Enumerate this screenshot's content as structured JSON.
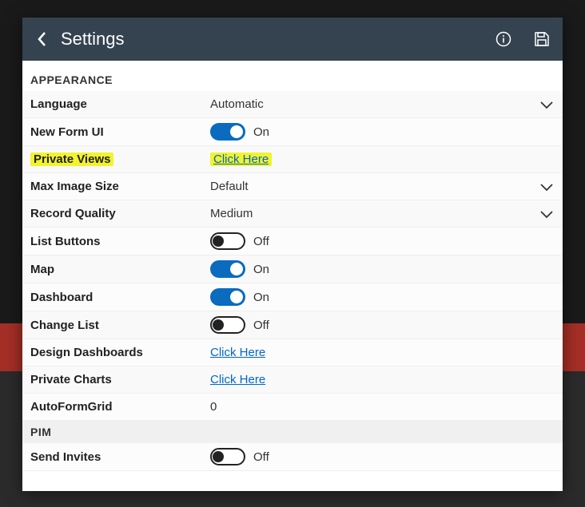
{
  "header": {
    "title": "Settings"
  },
  "sections": {
    "appearance": {
      "title": "APPEARANCE",
      "language": {
        "label": "Language",
        "value": "Automatic"
      },
      "newFormUI": {
        "label": "New Form UI",
        "value": "On",
        "on": true
      },
      "privateViews": {
        "label": "Private Views",
        "value": "Click Here"
      },
      "maxImageSize": {
        "label": "Max Image Size",
        "value": "Default"
      },
      "recordQuality": {
        "label": "Record Quality",
        "value": "Medium"
      },
      "listButtons": {
        "label": "List Buttons",
        "value": "Off",
        "on": false
      },
      "map": {
        "label": "Map",
        "value": "On",
        "on": true
      },
      "dashboard": {
        "label": "Dashboard",
        "value": "On",
        "on": true
      },
      "changeList": {
        "label": "Change List",
        "value": "Off",
        "on": false
      },
      "designDashboards": {
        "label": "Design Dashboards",
        "value": "Click Here"
      },
      "privateCharts": {
        "label": "Private Charts",
        "value": "Click Here"
      },
      "autoFormGrid": {
        "label": "AutoFormGrid",
        "value": "0"
      }
    },
    "pim": {
      "title": "PIM",
      "sendInvites": {
        "label": "Send Invites",
        "value": "Off",
        "on": false
      }
    }
  }
}
